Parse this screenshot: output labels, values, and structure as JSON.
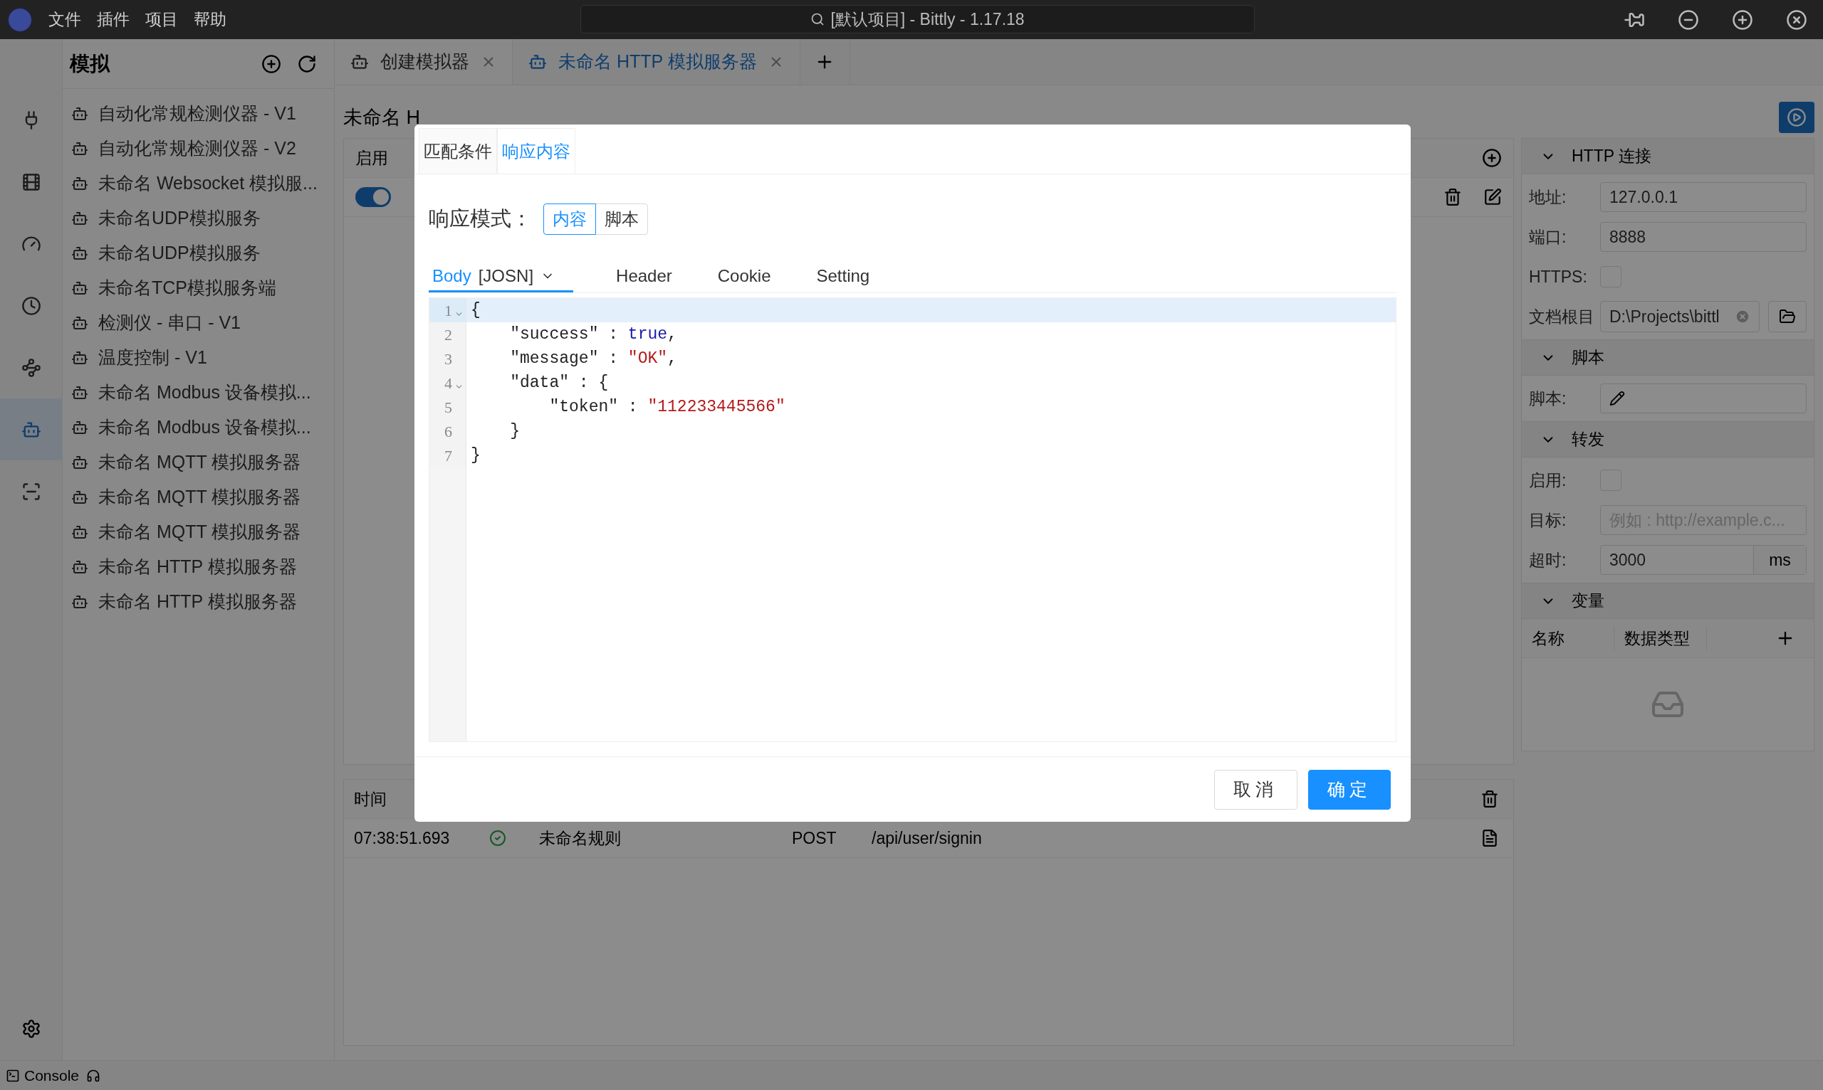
{
  "titlebar": {
    "menu": [
      "文件",
      "插件",
      "项目",
      "帮助"
    ],
    "search": "[默认项目] - Bittly - 1.17.18"
  },
  "activity_bar": [
    {
      "selected": false
    },
    {
      "selected": false
    },
    {
      "selected": false
    },
    {
      "selected": false
    },
    {
      "selected": false
    },
    {
      "selected": true
    },
    {
      "selected": false
    }
  ],
  "sidebar": {
    "title": "模拟",
    "items": [
      "自动化常规检测仪器 - V1",
      "自动化常规检测仪器 - V2",
      "未命名 Websocket 模拟服...",
      "未命名UDP模拟服务",
      "未命名UDP模拟服务",
      "未命名TCP模拟服务端",
      "检测仪 - 串口 - V1",
      "温度控制 - V1",
      "未命名 Modbus 设备模拟...",
      "未命名 Modbus 设备模拟...",
      "未命名 MQTT 模拟服务器",
      "未命名 MQTT 模拟服务器",
      "未命名 MQTT 模拟服务器",
      "未命名 HTTP 模拟服务器",
      "未命名 HTTP 模拟服务器"
    ]
  },
  "tabs": [
    {
      "label": "创建模拟器",
      "selected": false
    },
    {
      "label": "未命名 HTTP 模拟服务器",
      "selected": true
    }
  ],
  "page": {
    "title": "未命名 H",
    "rules": {
      "column": "启用",
      "rows": [
        {
          "enabled": true
        }
      ]
    }
  },
  "log": {
    "column": "时间",
    "rows": [
      {
        "time": "07:38:51.693",
        "ok": true,
        "rule": "未命名规则",
        "method": "POST",
        "path": "/api/user/signin"
      }
    ]
  },
  "right_panel": [
    {
      "title": "HTTP 连接",
      "expanded": true,
      "fields": [
        {
          "kind": "text",
          "label": "地址:",
          "value": "127.0.0.1"
        },
        {
          "kind": "text",
          "label": "端口:",
          "value": "8888"
        },
        {
          "kind": "checkbox",
          "label": "HTTPS:",
          "checked": false
        },
        {
          "kind": "path",
          "label": "文档根目",
          "value": "D:\\Projects\\bittl"
        }
      ]
    },
    {
      "title": "脚本",
      "expanded": true,
      "fields": [
        {
          "kind": "script",
          "label": "脚本:"
        }
      ]
    },
    {
      "title": "转发",
      "expanded": true,
      "fields": [
        {
          "kind": "checkbox",
          "label": "启用:",
          "checked": false
        },
        {
          "kind": "text",
          "label": "目标:",
          "placeholder": "例如 : http://example.c..."
        },
        {
          "kind": "unit",
          "label": "超时:",
          "value": "3000",
          "unit": "ms"
        }
      ]
    },
    {
      "title": "变量",
      "expanded": true,
      "table": {
        "columns": [
          "名称",
          "数据类型"
        ]
      }
    }
  ],
  "status_bar": {
    "console": "Console"
  },
  "dialog": {
    "tabs": [
      {
        "label": "匹配条件",
        "selected": false
      },
      {
        "label": "响应内容",
        "selected": true
      }
    ],
    "mode_label": "响应模式：",
    "modes": [
      {
        "label": "内容",
        "selected": true
      },
      {
        "label": "脚本",
        "selected": false
      }
    ],
    "body_tabs": [
      {
        "label": "Body",
        "extra": "[JOSN]",
        "selected": true
      },
      {
        "label": "Header",
        "selected": false
      },
      {
        "label": "Cookie",
        "selected": false
      },
      {
        "label": "Setting",
        "selected": false
      }
    ],
    "code": [
      {
        "line": "1",
        "foldable": true,
        "active": true,
        "tokens": [
          {
            "kind": "plain",
            "t": "{"
          }
        ]
      },
      {
        "line": "2",
        "foldable": false,
        "active": false,
        "tokens": [
          {
            "kind": "plain",
            "t": "    \"success\" : "
          },
          {
            "kind": "keyword",
            "t": "true"
          },
          {
            "kind": "plain",
            "t": ","
          }
        ]
      },
      {
        "line": "3",
        "foldable": false,
        "active": false,
        "tokens": [
          {
            "kind": "plain",
            "t": "    \"message\" : "
          },
          {
            "kind": "string",
            "t": "\"OK\""
          },
          {
            "kind": "plain",
            "t": ","
          }
        ]
      },
      {
        "line": "4",
        "foldable": true,
        "active": false,
        "tokens": [
          {
            "kind": "plain",
            "t": "    \"data\" : {"
          }
        ]
      },
      {
        "line": "5",
        "foldable": false,
        "active": false,
        "tokens": [
          {
            "kind": "plain",
            "t": "        \"token\" : "
          },
          {
            "kind": "string",
            "t": "\"112233445566\""
          }
        ]
      },
      {
        "line": "6",
        "foldable": false,
        "active": false,
        "tokens": [
          {
            "kind": "plain",
            "t": "    }"
          }
        ]
      },
      {
        "line": "7",
        "foldable": false,
        "active": false,
        "tokens": [
          {
            "kind": "plain",
            "t": "}"
          }
        ]
      }
    ],
    "buttons": [
      {
        "label": "取消",
        "kind": "secondary"
      },
      {
        "label": "确定",
        "kind": "primary"
      }
    ]
  }
}
